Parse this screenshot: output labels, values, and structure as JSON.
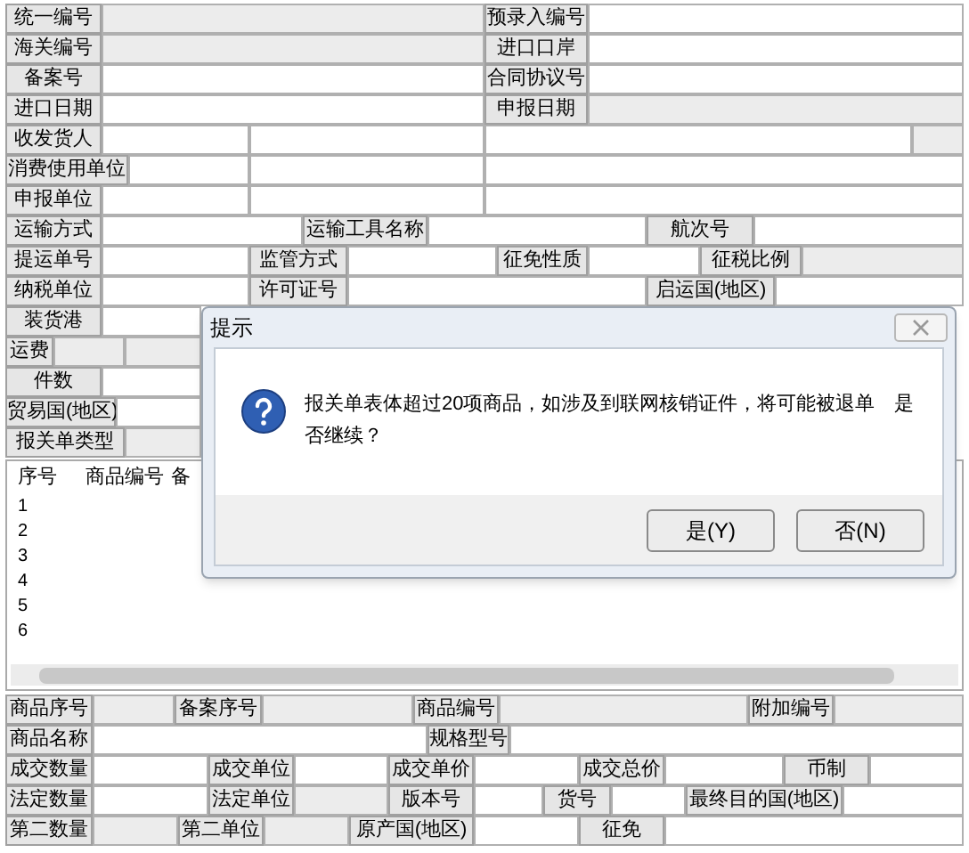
{
  "top_form": {
    "header_rows": [
      {
        "cells": [
          {
            "kind": "label",
            "text": "统一编号"
          },
          {
            "kind": "field",
            "disabled": true
          },
          {
            "kind": "label",
            "text": "预录入编号"
          },
          {
            "kind": "field",
            "disabled": false
          }
        ]
      },
      {
        "cells": [
          {
            "kind": "label",
            "text": "海关编号"
          },
          {
            "kind": "field",
            "disabled": true
          },
          {
            "kind": "label",
            "text": "进口口岸"
          },
          {
            "kind": "field",
            "disabled": false
          }
        ]
      },
      {
        "cells": [
          {
            "kind": "label",
            "text": "备案号"
          },
          {
            "kind": "field",
            "disabled": false
          },
          {
            "kind": "label",
            "text": "合同协议号"
          },
          {
            "kind": "field",
            "disabled": false
          }
        ]
      },
      {
        "cells": [
          {
            "kind": "label",
            "text": "进口日期"
          },
          {
            "kind": "field",
            "disabled": false
          },
          {
            "kind": "label",
            "text": "申报日期"
          },
          {
            "kind": "field",
            "disabled": true
          }
        ]
      }
    ],
    "detail_rows": [
      {
        "cells": [
          {
            "kind": "label",
            "text": "收发货人"
          },
          {
            "kind": "field",
            "disabled": false
          },
          {
            "kind": "field",
            "disabled": false
          },
          {
            "kind": "field",
            "disabled": false
          },
          {
            "kind": "field",
            "disabled": true
          }
        ]
      },
      {
        "cells": [
          {
            "kind": "label",
            "text": "消费使用单位"
          },
          {
            "kind": "field",
            "disabled": false
          },
          {
            "kind": "field",
            "disabled": false
          },
          {
            "kind": "field",
            "disabled": false
          }
        ]
      },
      {
        "cells": [
          {
            "kind": "label",
            "text": "申报单位"
          },
          {
            "kind": "field",
            "disabled": false
          },
          {
            "kind": "field",
            "disabled": false
          },
          {
            "kind": "field",
            "disabled": false
          }
        ]
      },
      {
        "cells": [
          {
            "kind": "label",
            "text": "运输方式"
          },
          {
            "kind": "field",
            "disabled": false
          },
          {
            "kind": "label",
            "text": "运输工具名称"
          },
          {
            "kind": "field",
            "disabled": false
          },
          {
            "kind": "label",
            "text": "航次号"
          },
          {
            "kind": "field",
            "disabled": false
          }
        ]
      },
      {
        "cells": [
          {
            "kind": "label",
            "text": "提运单号"
          },
          {
            "kind": "field",
            "disabled": false
          },
          {
            "kind": "label",
            "text": "监管方式"
          },
          {
            "kind": "field",
            "disabled": false
          },
          {
            "kind": "label",
            "text": "征免性质"
          },
          {
            "kind": "field",
            "disabled": false
          },
          {
            "kind": "label",
            "text": "征税比例"
          },
          {
            "kind": "field",
            "disabled": true
          }
        ]
      },
      {
        "cells": [
          {
            "kind": "label",
            "text": "纳税单位"
          },
          {
            "kind": "field",
            "disabled": false
          },
          {
            "kind": "label",
            "text": "许可证号"
          },
          {
            "kind": "field",
            "disabled": false
          },
          {
            "kind": "label",
            "text": "启运国(地区)"
          },
          {
            "kind": "field",
            "disabled": false
          }
        ]
      },
      {
        "cells": [
          {
            "kind": "label",
            "text": "装货港"
          },
          {
            "kind": "field",
            "disabled": false
          }
        ]
      },
      {
        "cells": [
          {
            "kind": "label",
            "text": "运费"
          },
          {
            "kind": "field",
            "disabled": true
          },
          {
            "kind": "field",
            "disabled": true
          }
        ]
      },
      {
        "cells": [
          {
            "kind": "label",
            "text": "件数"
          },
          {
            "kind": "field",
            "disabled": false
          }
        ]
      },
      {
        "cells": [
          {
            "kind": "label",
            "text": "贸易国(地区)"
          },
          {
            "kind": "field",
            "disabled": false
          }
        ]
      },
      {
        "cells": [
          {
            "kind": "label",
            "text": "报关单类型"
          },
          {
            "kind": "field",
            "disabled": true
          }
        ]
      }
    ]
  },
  "goods_table": {
    "columns": [
      "序号",
      "商品编号",
      "备"
    ],
    "rows": [
      "1",
      "2",
      "3",
      "4",
      "5",
      "6"
    ]
  },
  "item_form": {
    "rows": [
      {
        "cells": [
          {
            "kind": "label",
            "text": "商品序号"
          },
          {
            "kind": "field",
            "disabled": true
          },
          {
            "kind": "label",
            "text": "备案序号"
          },
          {
            "kind": "field",
            "disabled": true
          },
          {
            "kind": "label",
            "text": "商品编号"
          },
          {
            "kind": "field",
            "disabled": true
          },
          {
            "kind": "label",
            "text": "附加编号"
          },
          {
            "kind": "field",
            "disabled": true
          }
        ]
      },
      {
        "cells": [
          {
            "kind": "label",
            "text": "商品名称"
          },
          {
            "kind": "field",
            "disabled": false
          },
          {
            "kind": "label",
            "text": "规格型号"
          },
          {
            "kind": "field",
            "disabled": false
          }
        ]
      },
      {
        "cells": [
          {
            "kind": "label",
            "text": "成交数量"
          },
          {
            "kind": "field",
            "disabled": false
          },
          {
            "kind": "label",
            "text": "成交单位"
          },
          {
            "kind": "field",
            "disabled": false
          },
          {
            "kind": "label",
            "text": "成交单价"
          },
          {
            "kind": "field",
            "disabled": false
          },
          {
            "kind": "label",
            "text": "成交总价"
          },
          {
            "kind": "field",
            "disabled": false
          },
          {
            "kind": "label",
            "text": "币制"
          },
          {
            "kind": "field",
            "disabled": false
          }
        ]
      },
      {
        "cells": [
          {
            "kind": "label",
            "text": "法定数量"
          },
          {
            "kind": "field",
            "disabled": false
          },
          {
            "kind": "label",
            "text": "法定单位"
          },
          {
            "kind": "field",
            "disabled": true
          },
          {
            "kind": "label",
            "text": "版本号"
          },
          {
            "kind": "field",
            "disabled": false
          },
          {
            "kind": "label",
            "text": "货号"
          },
          {
            "kind": "field",
            "disabled": false
          },
          {
            "kind": "label",
            "text": "最终目的国(地区)"
          },
          {
            "kind": "field",
            "disabled": false
          }
        ]
      },
      {
        "cells": [
          {
            "kind": "label",
            "text": "第二数量"
          },
          {
            "kind": "field",
            "disabled": true
          },
          {
            "kind": "label",
            "text": "第二单位"
          },
          {
            "kind": "field",
            "disabled": true
          },
          {
            "kind": "label",
            "text": "原产国(地区)"
          },
          {
            "kind": "field",
            "disabled": false
          },
          {
            "kind": "label",
            "text": "征免"
          },
          {
            "kind": "field",
            "disabled": false
          }
        ]
      }
    ]
  },
  "dialog": {
    "title": "提示",
    "message": "报关单表体超过20项商品，如涉及到联网核销证件，将可能被退单　是否继续？",
    "buttons": [
      "是(Y)",
      "否(N)"
    ]
  }
}
